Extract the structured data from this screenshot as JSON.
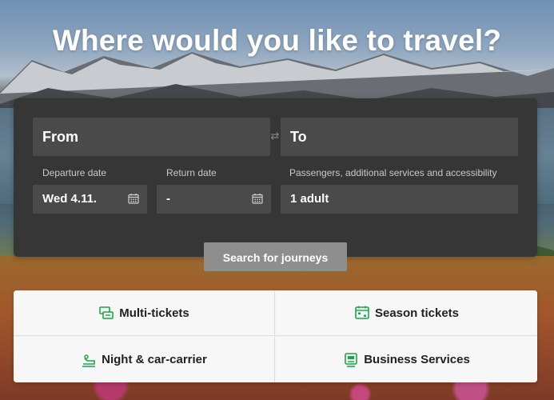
{
  "hero": {
    "headline": "Where would you like to travel?"
  },
  "search": {
    "from_label": "From",
    "to_label": "To",
    "departure_label": "Departure date",
    "departure_value": "Wed 4.11.",
    "return_label": "Return date",
    "return_value": "-",
    "passengers_label": "Passengers, additional services and accessibility",
    "passengers_value": "1 adult",
    "submit_label": "Search for journeys"
  },
  "services": [
    {
      "label": "Multi-tickets",
      "icon": "multi-ticket-icon"
    },
    {
      "label": "Season tickets",
      "icon": "season-ticket-icon"
    },
    {
      "label": "Night & car-carrier",
      "icon": "night-train-icon"
    },
    {
      "label": "Business Services",
      "icon": "business-icon"
    }
  ],
  "colors": {
    "accent": "#1aa646",
    "panel": "#363636",
    "field": "#4a4a4a",
    "button": "#8e8e8e"
  }
}
